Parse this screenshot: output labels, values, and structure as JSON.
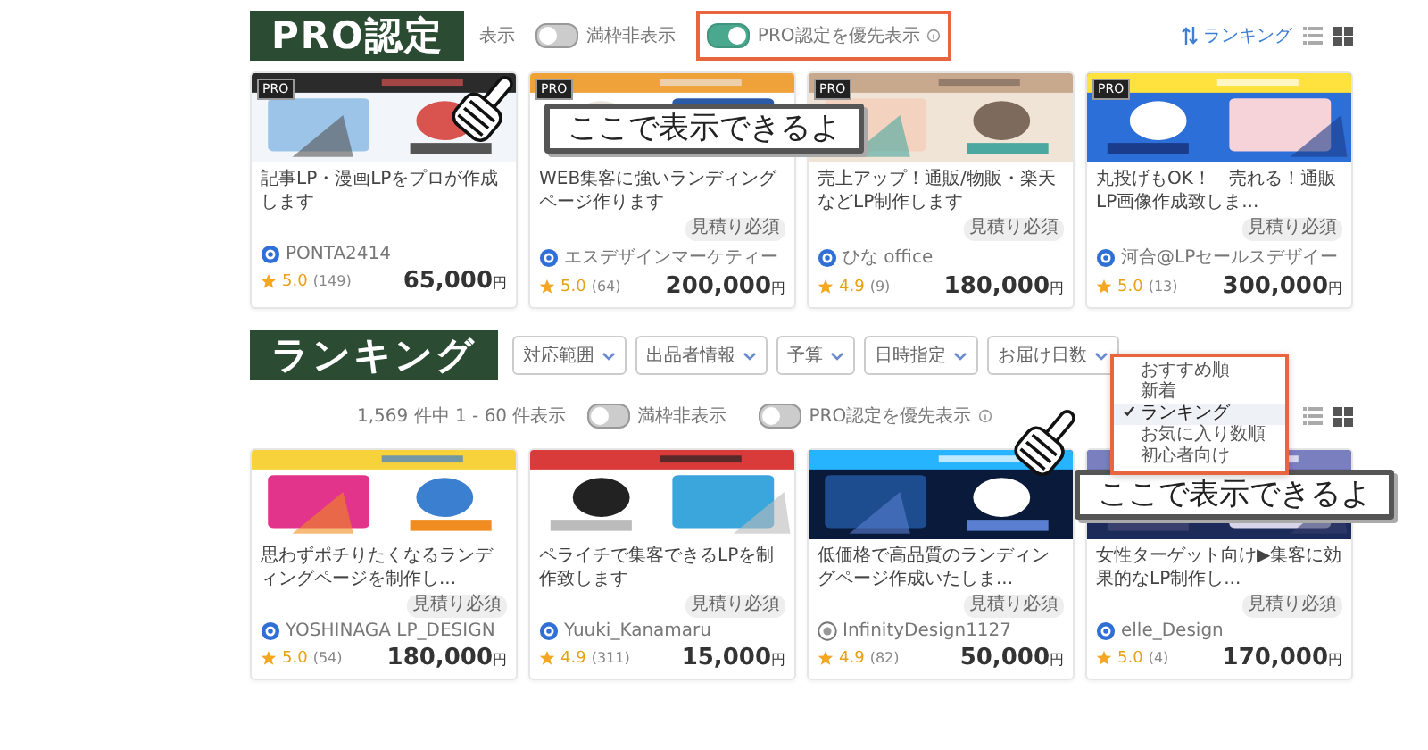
{
  "sections": [
    {
      "label": "PRO認定",
      "toolbar": {
        "cut_text": "表示",
        "toggles": [
          {
            "label": "満枠非表示",
            "on": false,
            "highlighted": false,
            "has_info": false
          },
          {
            "label": "PRO認定を優先表示",
            "on": true,
            "highlighted": true,
            "has_info": true
          }
        ],
        "sort": "ランキング",
        "views": [
          {
            "kind": "list",
            "selected": false
          },
          {
            "kind": "grid",
            "selected": true
          }
        ]
      },
      "cards": [
        {
          "pro_label": "PRO",
          "title": "記事LP・漫画LPをプロが作成します",
          "seller_pro": true,
          "seller": "PONTA2414",
          "rating": "5.0",
          "reviews": "(149)",
          "price": "65,000",
          "unit": "円"
        },
        {
          "pro_label": "PRO",
          "title": "WEB集客に強いランディングページ作ります",
          "badge": "見積り必須",
          "seller_pro": true,
          "seller": "エスデザインマーケティー",
          "rating": "5.0",
          "reviews": "(64)",
          "price": "200,000",
          "unit": "円"
        },
        {
          "pro_label": "PRO",
          "title": "売上アップ！通販/物販・楽天などLP制作します",
          "badge": "見積り必須",
          "seller_pro": true,
          "seller": "ひな office",
          "rating": "4.9",
          "reviews": "(9)",
          "price": "180,000",
          "unit": "円"
        },
        {
          "pro_label": "PRO",
          "title": "丸投げもOK！　売れる！通販LP画像作成致しま...",
          "badge": "見積り必須",
          "seller_pro": true,
          "seller": "河合@LPセールスデザイー",
          "rating": "5.0",
          "reviews": "(13)",
          "price": "300,000",
          "unit": "円"
        }
      ],
      "callout": "ここで表示できるよ"
    },
    {
      "label": "ランキング",
      "filters": [
        "対応範囲",
        "出品者情報",
        "予算",
        "日時指定",
        "お届け日数"
      ],
      "toolbar": {
        "count": "1,569 件中 1 - 60 件表示",
        "toggles": [
          {
            "label": "満枠非表示",
            "on": false,
            "highlighted": false,
            "has_info": false
          },
          {
            "label": "PRO認定を優先表示",
            "on": false,
            "highlighted": false,
            "has_info": true
          }
        ],
        "sort_menu": {
          "highlighted": true,
          "items": [
            {
              "label": "おすすめ順",
              "selected": false
            },
            {
              "label": "新着",
              "selected": false
            },
            {
              "label": "ランキング",
              "selected": true
            },
            {
              "label": "お気に入り数順",
              "selected": false
            },
            {
              "label": "初心者向け",
              "selected": false
            }
          ]
        },
        "views": [
          {
            "kind": "list",
            "selected": false
          },
          {
            "kind": "grid",
            "selected": true
          }
        ]
      },
      "cards": [
        {
          "title": "思わずポチりたくなるランディングページを制作し...",
          "badge": "見積り必須",
          "seller_pro": true,
          "seller": "YOSHINAGA LP_DESIGN",
          "rating": "5.0",
          "reviews": "(54)",
          "price": "180,000",
          "unit": "円"
        },
        {
          "title": "ペライチで集客できるLPを制作致します",
          "badge": "見積り必須",
          "seller_pro": true,
          "seller": "Yuuki_Kanamaru",
          "rating": "4.9",
          "reviews": "(311)",
          "price": "15,000",
          "unit": "円"
        },
        {
          "title": "低価格で高品質のランディングページ作成いたしま...",
          "badge": "見積り必須",
          "seller_pro": false,
          "seller": "InfinityDesign1127",
          "rating": "4.9",
          "reviews": "(82)",
          "price": "50,000",
          "unit": "円"
        },
        {
          "title": "女性ターゲット向け▶集客に効果的なLP制作し...",
          "badge": "見積り必須",
          "seller_pro": true,
          "seller": "elle_Design",
          "rating": "5.0",
          "reviews": "(4)",
          "price": "170,000",
          "unit": "円"
        }
      ],
      "callout": "ここで表示できるよ"
    }
  ]
}
